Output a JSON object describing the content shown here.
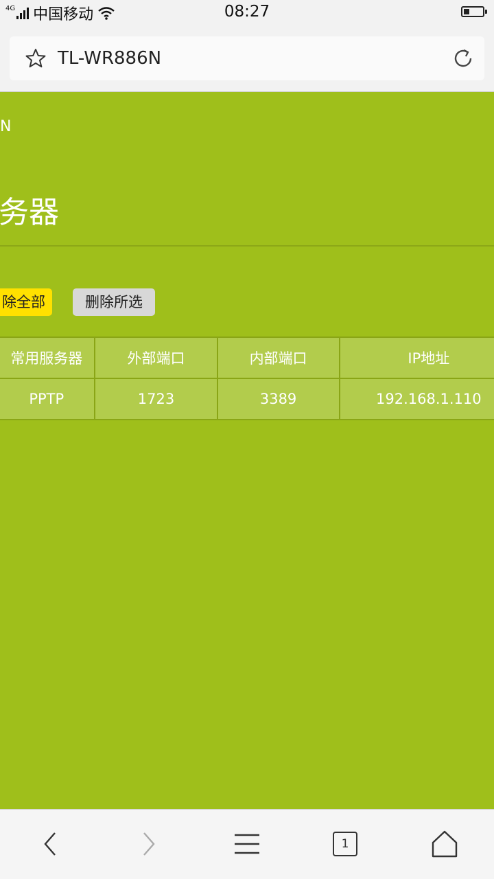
{
  "status_bar": {
    "network": "4G",
    "carrier": "中国移动",
    "time": "08:27",
    "battery_level": 0.3
  },
  "browser": {
    "title": "TL-WR886N",
    "tab_count": "1",
    "icons": {
      "favorite": "star-icon",
      "reload": "reload-icon",
      "back": "chevron-left-icon",
      "forward": "chevron-right-icon",
      "menu": "hamburger-menu-icon",
      "tabs": "tabs-icon",
      "home": "home-icon"
    }
  },
  "page": {
    "model_fragment": "N",
    "heading_fragment": "务器",
    "buttons": {
      "delete_all": "除全部",
      "delete_selected": "删除所选"
    },
    "table": {
      "headers": [
        "常用服务器",
        "外部端口",
        "内部端口",
        "IP地址"
      ],
      "rows": [
        [
          "PPTP",
          "1723",
          "3389",
          "192.168.1.110"
        ]
      ]
    }
  },
  "colors": {
    "page_bg": "#9fbf1b",
    "table_cell": "#b2cc4c",
    "delete_all_btn": "#ffe100",
    "delete_selected_btn": "#d8d8d8"
  }
}
